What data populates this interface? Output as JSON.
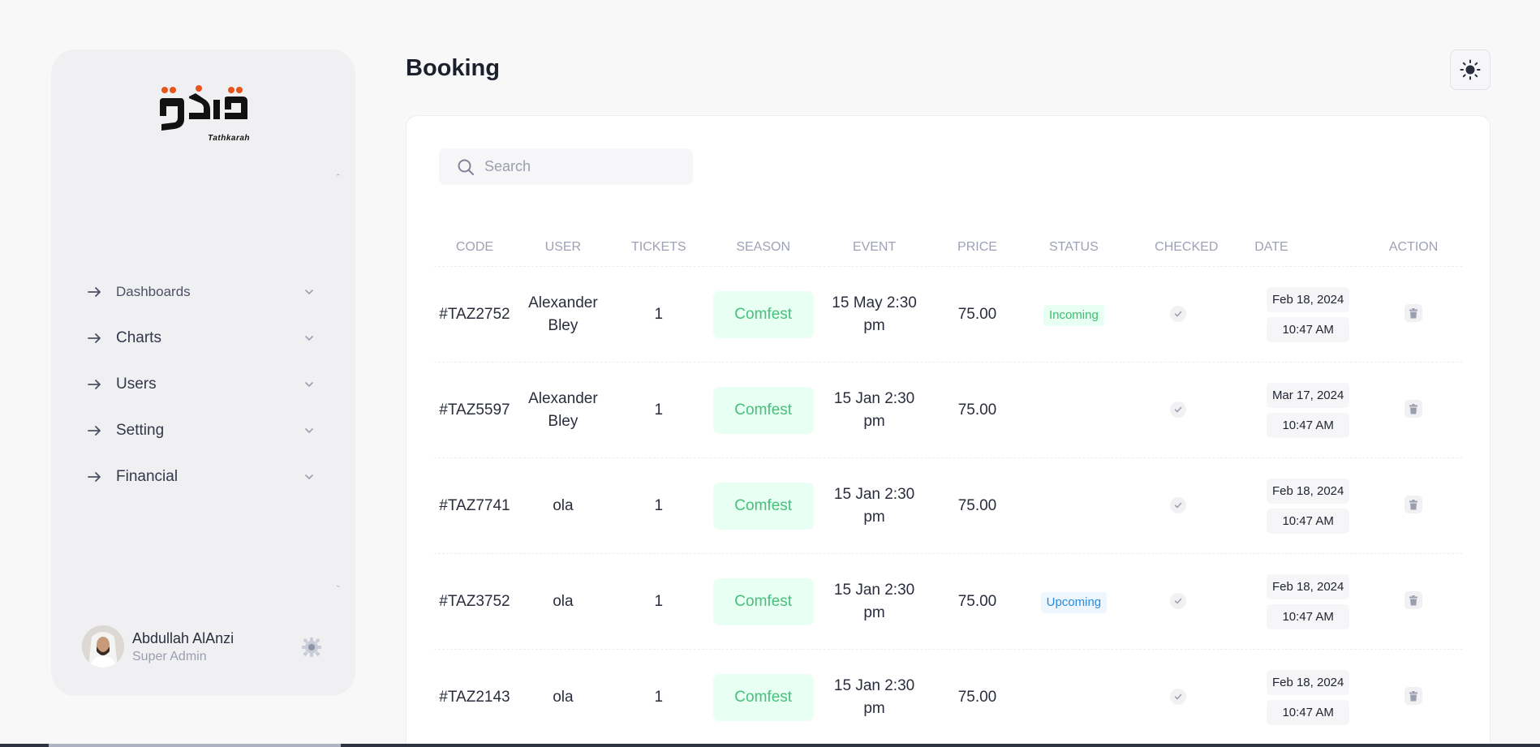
{
  "sidebar": {
    "logo_sub": "Tathkarah",
    "nav": [
      {
        "label": "Dashboards",
        "name": "dashboards",
        "small": true
      },
      {
        "label": "Charts",
        "name": "charts",
        "small": false
      },
      {
        "label": "Users",
        "name": "users",
        "small": false
      },
      {
        "label": "Setting",
        "name": "setting",
        "small": false
      },
      {
        "label": "Financial",
        "name": "financial",
        "small": false
      }
    ],
    "profile": {
      "name": "Abdullah AlAnzi",
      "role": "Super Admin"
    }
  },
  "header": {
    "title": "Booking"
  },
  "search": {
    "placeholder": "Search"
  },
  "table": {
    "columns": [
      "CODE",
      "USER",
      "TICKETS",
      "SEASON",
      "EVENT",
      "PRICE",
      "STATUS",
      "CHECKED",
      "DATE",
      "ACTION"
    ],
    "rows": [
      {
        "code": "#TAZ2752",
        "user": [
          "Alexander",
          "Bley"
        ],
        "tickets": "1",
        "season": "Comfest",
        "event": [
          "15 May 2:30",
          "pm"
        ],
        "price": "75.00",
        "status": "Incoming",
        "status_type": "incoming",
        "date": "Feb 18, 2024",
        "time": "10:47 AM"
      },
      {
        "code": "#TAZ5597",
        "user": [
          "Alexander",
          "Bley"
        ],
        "tickets": "1",
        "season": "Comfest",
        "event": [
          "15 Jan 2:30",
          "pm"
        ],
        "price": "75.00",
        "status": "",
        "status_type": "",
        "date": "Mar 17, 2024",
        "time": "10:47 AM"
      },
      {
        "code": "#TAZ7741",
        "user": [
          "ola"
        ],
        "tickets": "1",
        "season": "Comfest",
        "event": [
          "15 Jan 2:30",
          "pm"
        ],
        "price": "75.00",
        "status": "",
        "status_type": "",
        "date": "Feb 18, 2024",
        "time": "10:47 AM"
      },
      {
        "code": "#TAZ3752",
        "user": [
          "ola"
        ],
        "tickets": "1",
        "season": "Comfest",
        "event": [
          "15 Jan 2:30",
          "pm"
        ],
        "price": "75.00",
        "status": "Upcoming",
        "status_type": "upcoming",
        "date": "Feb 18, 2024",
        "time": "10:47 AM"
      },
      {
        "code": "#TAZ2143",
        "user": [
          "ola"
        ],
        "tickets": "1",
        "season": "Comfest",
        "event": [
          "15 Jan 2:30",
          "pm"
        ],
        "price": "75.00",
        "status": "",
        "status_type": "",
        "date": "Feb 18, 2024",
        "time": "10:47 AM"
      }
    ]
  },
  "colors": {
    "accent_green": "#45c17a",
    "logo_dots": "#e8541c",
    "status_upcoming": "#2a8bd8"
  }
}
